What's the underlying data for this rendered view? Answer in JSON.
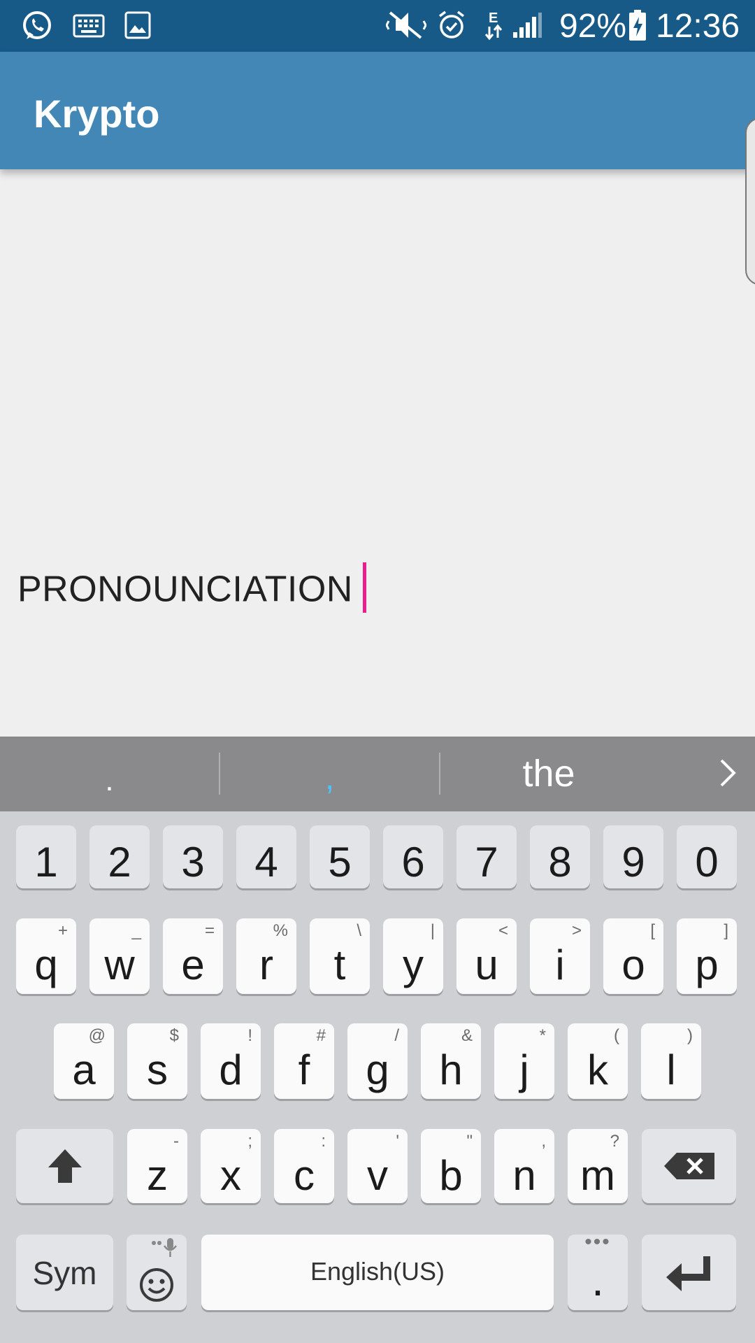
{
  "status_bar": {
    "battery": "92%",
    "time": "12:36",
    "icons": [
      "whatsapp-icon",
      "keyboard-icon",
      "image-icon",
      "mute-icon",
      "alarm-icon",
      "data-e-icon",
      "signal-icon",
      "battery-charging-icon"
    ]
  },
  "app_bar": {
    "title": "Krypto"
  },
  "editor": {
    "text": "PRONOUNCIATION"
  },
  "suggestions": {
    "items": [
      ".",
      ",",
      "the"
    ]
  },
  "keyboard": {
    "number_row": [
      "1",
      "2",
      "3",
      "4",
      "5",
      "6",
      "7",
      "8",
      "9",
      "0"
    ],
    "row1": [
      {
        "key": "q",
        "sub": "+"
      },
      {
        "key": "w",
        "sub": "_"
      },
      {
        "key": "e",
        "sub": "="
      },
      {
        "key": "r",
        "sub": "%"
      },
      {
        "key": "t",
        "sub": "\\"
      },
      {
        "key": "y",
        "sub": "|"
      },
      {
        "key": "u",
        "sub": "<"
      },
      {
        "key": "i",
        "sub": ">"
      },
      {
        "key": "o",
        "sub": "["
      },
      {
        "key": "p",
        "sub": "]"
      }
    ],
    "row2": [
      {
        "key": "a",
        "sub": "@"
      },
      {
        "key": "s",
        "sub": "$"
      },
      {
        "key": "d",
        "sub": "!"
      },
      {
        "key": "f",
        "sub": "#"
      },
      {
        "key": "g",
        "sub": "/"
      },
      {
        "key": "h",
        "sub": "&"
      },
      {
        "key": "j",
        "sub": "*"
      },
      {
        "key": "k",
        "sub": "("
      },
      {
        "key": "l",
        "sub": ")"
      }
    ],
    "row3": [
      {
        "key": "z",
        "sub": "-"
      },
      {
        "key": "x",
        "sub": ";"
      },
      {
        "key": "c",
        "sub": ":"
      },
      {
        "key": "v",
        "sub": "'"
      },
      {
        "key": "b",
        "sub": "\""
      },
      {
        "key": "n",
        "sub": ","
      },
      {
        "key": "m",
        "sub": "?"
      }
    ],
    "sym_label": "Sym",
    "space_label": "English(US)",
    "period_label": "."
  },
  "colors": {
    "status_bar": "#175a87",
    "app_bar": "#4287b5",
    "cursor": "#e91e8c",
    "suggestion_bar": "#8a8a8c",
    "keyboard_bg": "#cfd0d4"
  }
}
